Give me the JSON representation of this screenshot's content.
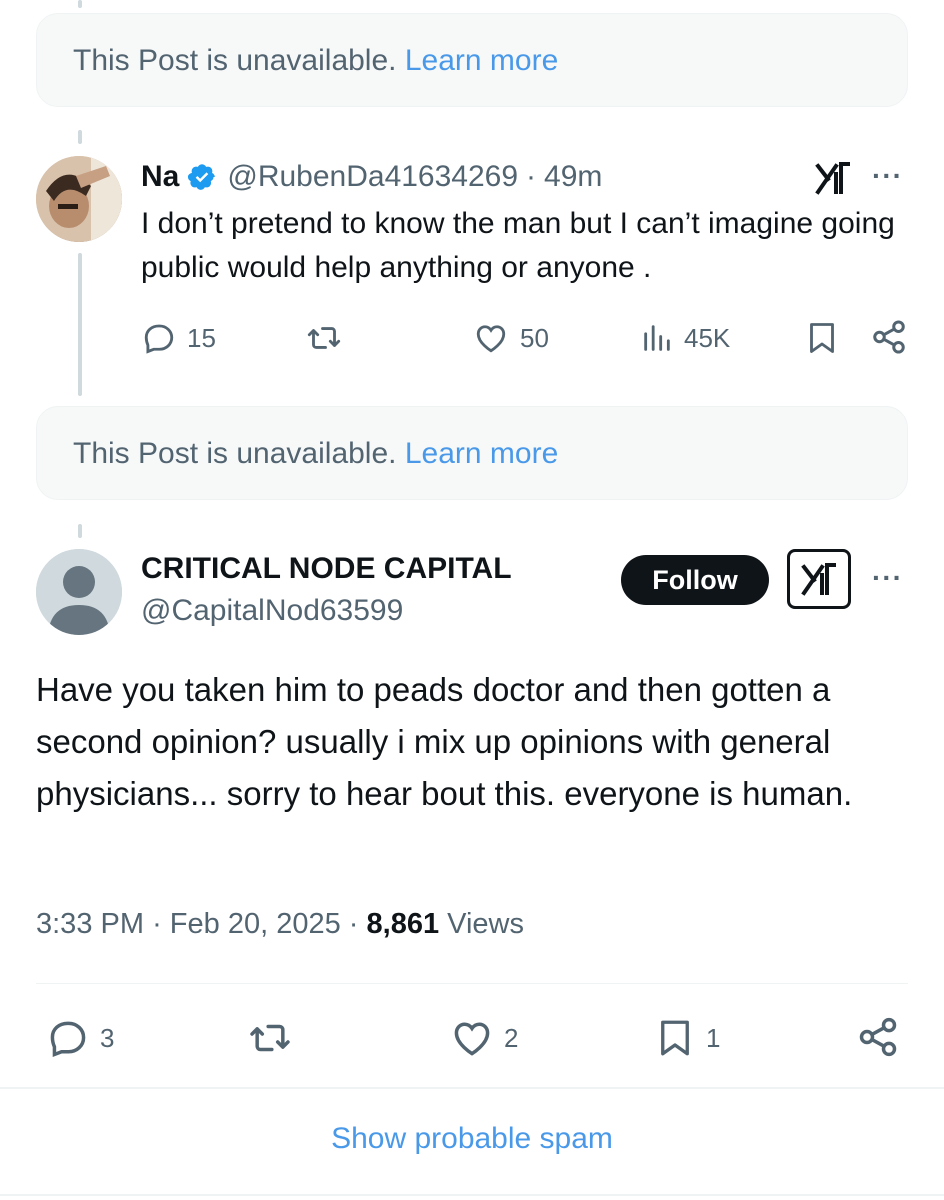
{
  "unavailable_notice": {
    "text": "This Post is unavailable.",
    "link": "Learn more"
  },
  "reply": {
    "display_name": "Na",
    "verified": true,
    "handle": "@RubenDa41634269",
    "separator": "·",
    "time": "49m",
    "text": "I don’t pretend to know the man but I can’t imagine going public would help anything or anyone .",
    "metrics": {
      "replies": "15",
      "reposts": "",
      "likes": "50",
      "views": "45K"
    }
  },
  "main_post": {
    "display_name": "CRITICAL NODE CAPITAL",
    "handle": "@CapitalNod63599",
    "follow_label": "Follow",
    "text": "Have you taken him to peads doctor and then gotten a second opinion? usually i mix up opinions with general physicians... sorry to hear bout this. everyone is human.",
    "time": "3:33 PM",
    "date": "Feb 20, 2025",
    "views_count": "8,861",
    "views_label": "Views",
    "separator": "·",
    "metrics": {
      "replies": "3",
      "likes": "2",
      "bookmarks": "1"
    }
  },
  "show_spam_label": "Show probable spam",
  "colors": {
    "link": "#4a99e9",
    "secondary_text": "#536471",
    "verified": "#1d9bf0"
  },
  "icons": [
    "reply-icon",
    "repost-icon",
    "like-icon",
    "views-icon",
    "bookmark-icon",
    "share-icon",
    "grok-icon",
    "more-icon",
    "verified-badge-icon"
  ]
}
